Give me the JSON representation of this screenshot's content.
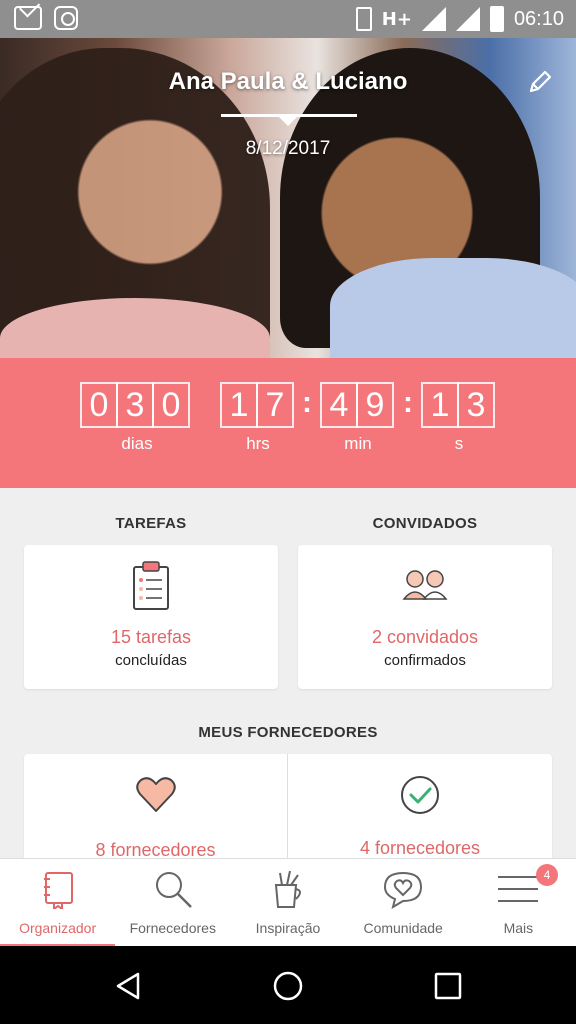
{
  "status_bar": {
    "time": "06:10",
    "network": "H+"
  },
  "hero": {
    "couple_names": "Ana Paula & Luciano",
    "wedding_date": "8/12/2017"
  },
  "countdown": {
    "days": [
      "0",
      "3",
      "0"
    ],
    "days_label": "dias",
    "hours": [
      "1",
      "7"
    ],
    "hours_label": "hrs",
    "minutes": [
      "4",
      "9"
    ],
    "minutes_label": "min",
    "seconds": [
      "1",
      "3"
    ],
    "seconds_label": "s"
  },
  "tasks": {
    "title": "TAREFAS",
    "count": "15 tarefas",
    "subtitle": "concluídas"
  },
  "guests": {
    "title": "CONVIDADOS",
    "count": "2 convidados",
    "subtitle": "confirmados"
  },
  "vendors": {
    "title": "MEUS FORNECEDORES",
    "favorites": "8 fornecedores",
    "hired": "4 fornecedores"
  },
  "nav": {
    "items": [
      {
        "label": "Organizador",
        "icon": "notebook-icon"
      },
      {
        "label": "Fornecedores",
        "icon": "search-icon"
      },
      {
        "label": "Inspiração",
        "icon": "inspiration-cup-icon"
      },
      {
        "label": "Comunidade",
        "icon": "chat-heart-icon"
      },
      {
        "label": "Mais",
        "icon": "menu-icon",
        "badge": "4"
      }
    ]
  },
  "colors": {
    "accent": "#f4767a",
    "accent_text": "#e06768"
  }
}
